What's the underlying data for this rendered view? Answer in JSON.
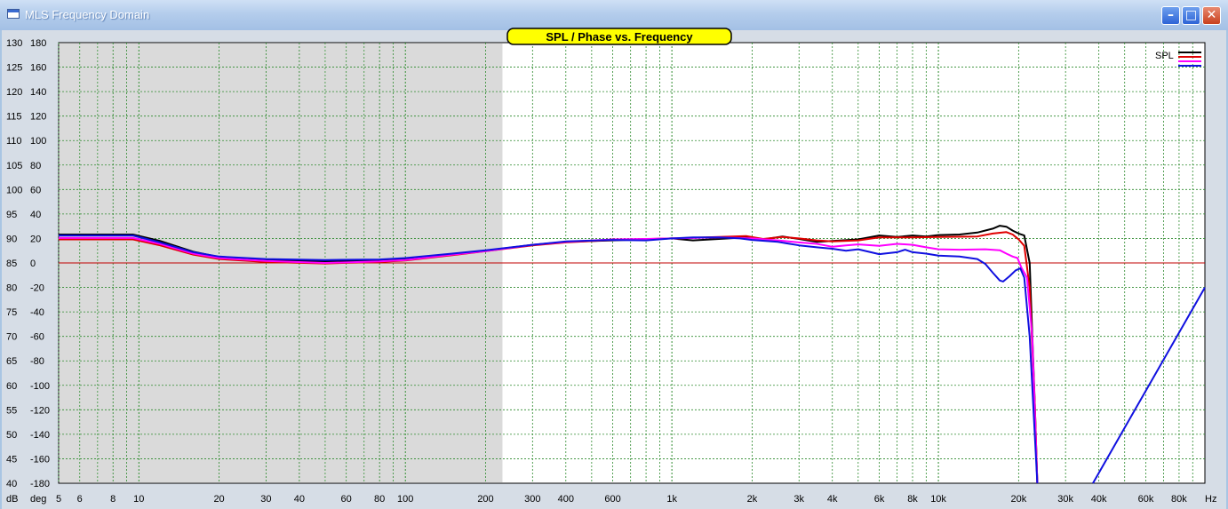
{
  "window": {
    "title": "MLS Frequency Domain",
    "min_icon": "minimize-icon",
    "max_icon": "maximize-icon",
    "close_icon": "close-icon"
  },
  "chart_data": {
    "type": "line",
    "title": "SPL / Phase vs. Frequency",
    "x_scale": "log",
    "xlim": [
      5,
      100000
    ],
    "xunit": "Hz",
    "spl_unit": "dB",
    "phase_unit": "deg",
    "spl_ticks": [
      130,
      125,
      120,
      115,
      110,
      105,
      100,
      95,
      90,
      85,
      80,
      75,
      70,
      65,
      60,
      55,
      50,
      45,
      40
    ],
    "phase_ticks": [
      180,
      160,
      140,
      120,
      100,
      80,
      60,
      40,
      20,
      0,
      -20,
      -40,
      -60,
      -80,
      -100,
      -120,
      -140,
      -160,
      -180
    ],
    "x_ticks": [
      {
        "v": 5,
        "label": "5"
      },
      {
        "v": 6,
        "label": "6"
      },
      {
        "v": 8,
        "label": "8"
      },
      {
        "v": 10,
        "label": "10"
      },
      {
        "v": 20,
        "label": "20"
      },
      {
        "v": 30,
        "label": "30"
      },
      {
        "v": 40,
        "label": "40"
      },
      {
        "v": 60,
        "label": "60"
      },
      {
        "v": 80,
        "label": "80"
      },
      {
        "v": 100,
        "label": "100"
      },
      {
        "v": 200,
        "label": "200"
      },
      {
        "v": 300,
        "label": "300"
      },
      {
        "v": 400,
        "label": "400"
      },
      {
        "v": 600,
        "label": "600"
      },
      {
        "v": 1000,
        "label": "1k"
      },
      {
        "v": 2000,
        "label": "2k"
      },
      {
        "v": 3000,
        "label": "3k"
      },
      {
        "v": 4000,
        "label": "4k"
      },
      {
        "v": 6000,
        "label": "6k"
      },
      {
        "v": 8000,
        "label": "8k"
      },
      {
        "v": 10000,
        "label": "10k"
      },
      {
        "v": 20000,
        "label": "20k"
      },
      {
        "v": 30000,
        "label": "30k"
      },
      {
        "v": 40000,
        "label": "40k"
      },
      {
        "v": 60000,
        "label": "60k"
      },
      {
        "v": 80000,
        "label": "80k"
      }
    ],
    "shaded_region_below_hz": 230,
    "reference_line_db": 85,
    "legend": {
      "label": "SPL",
      "position": "top-right"
    },
    "colors": {
      "black": "#000000",
      "red": "#e00000",
      "magenta": "#ff00ff",
      "blue": "#1010e0",
      "ref": "#c00000",
      "grid": "#2d8a2d"
    },
    "series": [
      {
        "color": "black",
        "unit": "dB",
        "points": [
          [
            5,
            90.8
          ],
          [
            9.5,
            90.8
          ],
          [
            12,
            89.5
          ],
          [
            16,
            87.3
          ],
          [
            20,
            86.2
          ],
          [
            30,
            85.6
          ],
          [
            50,
            85.3
          ],
          [
            80,
            85.5
          ],
          [
            100,
            85.8
          ],
          [
            150,
            86.8
          ],
          [
            200,
            87.5
          ],
          [
            300,
            88.7
          ],
          [
            400,
            89.3
          ],
          [
            600,
            89.6
          ],
          [
            1000,
            90
          ],
          [
            1200,
            89.6
          ],
          [
            1500,
            89.9
          ],
          [
            1900,
            90.2
          ],
          [
            2200,
            89.8
          ],
          [
            2600,
            90.4
          ],
          [
            3000,
            89.9
          ],
          [
            3500,
            89.3
          ],
          [
            4000,
            89.5
          ],
          [
            5000,
            89.8
          ],
          [
            6000,
            90.6
          ],
          [
            7000,
            90.3
          ],
          [
            8000,
            90.6
          ],
          [
            9000,
            90.4
          ],
          [
            10000,
            90.7
          ],
          [
            12000,
            90.8
          ],
          [
            14000,
            91.2
          ],
          [
            16000,
            92
          ],
          [
            17000,
            92.6
          ],
          [
            18000,
            92.4
          ],
          [
            19000,
            91.6
          ],
          [
            20000,
            91
          ],
          [
            21000,
            90.6
          ],
          [
            22000,
            85
          ],
          [
            23000,
            56
          ],
          [
            23500,
            40
          ]
        ]
      },
      {
        "color": "red",
        "unit": "dB",
        "points": [
          [
            5,
            89.8
          ],
          [
            9.5,
            89.8
          ],
          [
            12,
            88.6
          ],
          [
            16,
            86.7
          ],
          [
            20,
            85.8
          ],
          [
            30,
            85.2
          ],
          [
            50,
            84.9
          ],
          [
            80,
            85.2
          ],
          [
            100,
            85.5
          ],
          [
            150,
            86.6
          ],
          [
            200,
            87.4
          ],
          [
            300,
            88.6
          ],
          [
            400,
            89.2
          ],
          [
            600,
            89.7
          ],
          [
            1000,
            90
          ],
          [
            1500,
            90.3
          ],
          [
            1900,
            90.5
          ],
          [
            2200,
            89.9
          ],
          [
            2600,
            90.3
          ],
          [
            3000,
            90
          ],
          [
            3500,
            89.6
          ],
          [
            4000,
            89.4
          ],
          [
            5000,
            89.6
          ],
          [
            6000,
            90.2
          ],
          [
            8000,
            90.2
          ],
          [
            10000,
            90.3
          ],
          [
            14000,
            90.4
          ],
          [
            16000,
            91
          ],
          [
            18000,
            91.3
          ],
          [
            19000,
            90.8
          ],
          [
            20000,
            89.8
          ],
          [
            21000,
            88.5
          ],
          [
            22000,
            80
          ],
          [
            23000,
            56
          ],
          [
            23500,
            40
          ]
        ]
      },
      {
        "color": "magenta",
        "unit": "dB",
        "points": [
          [
            5,
            90.1
          ],
          [
            9.5,
            90.1
          ],
          [
            12,
            88.9
          ],
          [
            16,
            86.9
          ],
          [
            20,
            86
          ],
          [
            30,
            85.4
          ],
          [
            50,
            85
          ],
          [
            80,
            85.3
          ],
          [
            100,
            85.6
          ],
          [
            150,
            86.7
          ],
          [
            200,
            87.4
          ],
          [
            300,
            88.7
          ],
          [
            400,
            89.3
          ],
          [
            600,
            89.8
          ],
          [
            800,
            89.9
          ],
          [
            1000,
            90
          ],
          [
            1500,
            90.2
          ],
          [
            2000,
            90
          ],
          [
            2500,
            89.6
          ],
          [
            3000,
            89.2
          ],
          [
            3500,
            88.9
          ],
          [
            4000,
            88.3
          ],
          [
            4500,
            88.6
          ],
          [
            5000,
            88.8
          ],
          [
            6000,
            88.5
          ],
          [
            7000,
            88.9
          ],
          [
            8000,
            88.7
          ],
          [
            9000,
            88.2
          ],
          [
            10000,
            87.8
          ],
          [
            12000,
            87.7
          ],
          [
            15000,
            87.8
          ],
          [
            17000,
            87.6
          ],
          [
            18000,
            86.9
          ],
          [
            19000,
            86.3
          ],
          [
            19800,
            86
          ],
          [
            20500,
            84
          ],
          [
            21500,
            82
          ],
          [
            22500,
            70
          ],
          [
            23500,
            40
          ]
        ]
      },
      {
        "color": "blue",
        "unit": "dB",
        "points": [
          [
            5,
            90.6
          ],
          [
            9.5,
            90.6
          ],
          [
            12,
            89.2
          ],
          [
            16,
            87.2
          ],
          [
            20,
            86.3
          ],
          [
            30,
            85.8
          ],
          [
            50,
            85.6
          ],
          [
            80,
            85.7
          ],
          [
            100,
            86
          ],
          [
            150,
            86.9
          ],
          [
            200,
            87.6
          ],
          [
            300,
            88.7
          ],
          [
            400,
            89.4
          ],
          [
            600,
            89.7
          ],
          [
            800,
            89.6
          ],
          [
            1000,
            90
          ],
          [
            1200,
            90.2
          ],
          [
            1500,
            90.2
          ],
          [
            1800,
            90
          ],
          [
            2000,
            89.7
          ],
          [
            2500,
            89.3
          ],
          [
            3000,
            88.6
          ],
          [
            3500,
            88.2
          ],
          [
            4000,
            87.9
          ],
          [
            4500,
            87.5
          ],
          [
            5000,
            87.8
          ],
          [
            6000,
            86.8
          ],
          [
            7000,
            87.2
          ],
          [
            7500,
            87.7
          ],
          [
            8000,
            87.2
          ],
          [
            9000,
            86.9
          ],
          [
            10000,
            86.5
          ],
          [
            12000,
            86.3
          ],
          [
            14000,
            85.8
          ],
          [
            15000,
            84.8
          ],
          [
            16000,
            83
          ],
          [
            17000,
            81.4
          ],
          [
            17500,
            81.2
          ],
          [
            18500,
            82.3
          ],
          [
            19500,
            83.5
          ],
          [
            20300,
            83.9
          ],
          [
            21000,
            82
          ],
          [
            22000,
            70
          ],
          [
            23500,
            40
          ]
        ]
      },
      {
        "color": "blue",
        "unit": "deg",
        "points": [
          [
            38000,
            -180
          ],
          [
            100000,
            -20
          ]
        ]
      }
    ]
  }
}
